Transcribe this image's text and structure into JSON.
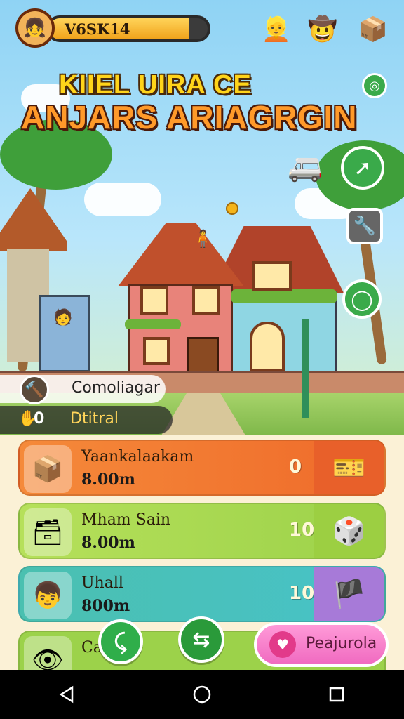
{
  "hud": {
    "player_name": "V6SK14",
    "xp_progress": 0.88,
    "avatar_icon": "girl-avatar-icon",
    "top_icons": [
      "character-yellow-icon",
      "character-hat-icon",
      "crate-icon"
    ]
  },
  "title": {
    "line1": "KIIEL UIRA CE",
    "line2": "ANJARS ARIAGRGIN"
  },
  "scene": {
    "side_buttons": [
      "share-arrow-icon",
      "wrench-icon",
      "cycle-icon"
    ],
    "strip1": {
      "label": "Comoliagar",
      "icon": "hammer-icon"
    },
    "strip2": {
      "count": "0",
      "label": "Dtitral",
      "icon": "hand-icon"
    }
  },
  "tasks": [
    {
      "name": "Yaankalaakam",
      "time": "8.00m",
      "count": "0",
      "thumb": "box-icon",
      "right": "ticket-icon",
      "color": "#ef6a2a"
    },
    {
      "name": "Mham Sain",
      "time": "8.00m",
      "count": "10",
      "thumb": "crate-icon",
      "right": "dice-icon",
      "color": "#9cd24a"
    },
    {
      "name": "Uhall",
      "time": "800m",
      "count": "10",
      "thumb": "boy-icon",
      "right": "pirate-icon",
      "color": "#48c2c8"
    },
    {
      "name": "Ca",
      "time": "",
      "count": "",
      "thumb": "eye-icon",
      "right": "",
      "color": "#9cd24a"
    }
  ],
  "actions": {
    "fab1": "lever-icon",
    "fab2": "swap-icon",
    "pill_label": "Peajurola",
    "pill_icon": "pink-badge-icon"
  },
  "nav": [
    "back-icon",
    "home-icon",
    "recents-icon"
  ]
}
